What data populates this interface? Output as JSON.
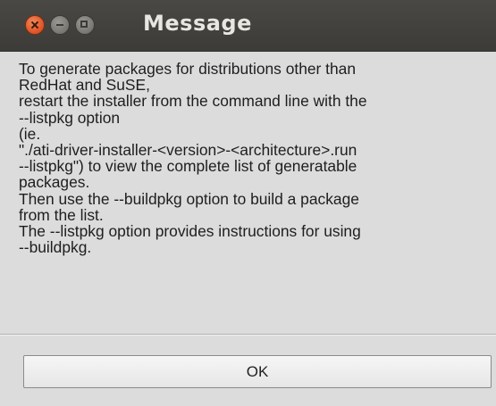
{
  "window": {
    "title": "Message",
    "controls": [
      "close-icon",
      "minimize-icon",
      "maximize-icon"
    ],
    "colors": {
      "titlebar": "#3c3b37",
      "close_button": "#e1582a",
      "body": "#dcdcdc"
    }
  },
  "message": {
    "lines": [
      "To generate packages for distributions other than",
      "RedHat and SuSE,",
      "restart the installer from the command line with the",
      "--listpkg option",
      "(ie.",
      "\"./ati-driver-installer-<version>-<architecture>.run",
      "--listpkg\") to view the complete list of generatable",
      "packages.",
      "Then use the --buildpkg option to build a package",
      "from the list.",
      "The --listpkg option provides instructions for using",
      "--buildpkg."
    ]
  },
  "buttons": {
    "ok_label": "OK"
  }
}
